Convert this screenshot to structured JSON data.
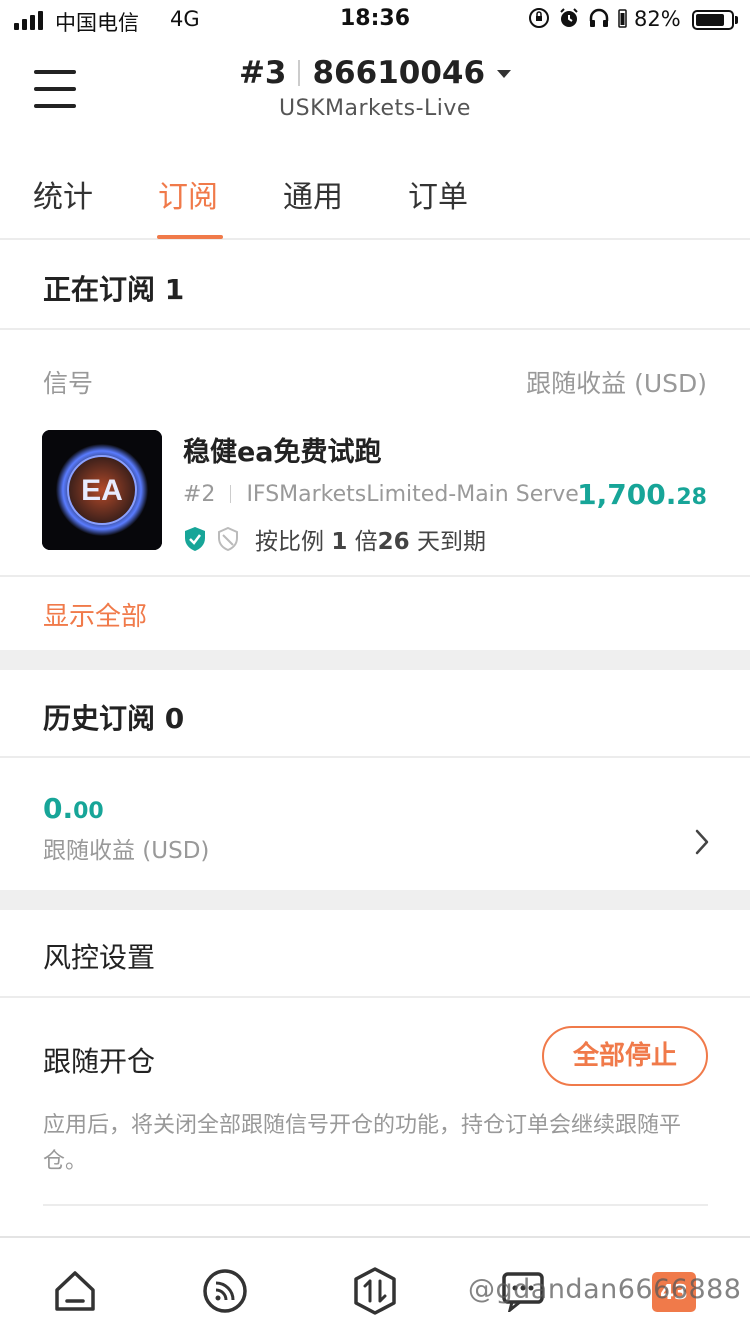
{
  "status_bar": {
    "carrier": "中国电信",
    "network": "4G",
    "time": "18:36",
    "battery": "82%",
    "battery_level": 0.82
  },
  "header": {
    "account_prefix": "#3",
    "account_number": "86610046",
    "server": "USKMarkets-Live"
  },
  "tabs": [
    {
      "label": "统计",
      "active": false
    },
    {
      "label": "订阅",
      "active": true
    },
    {
      "label": "通用",
      "active": false
    },
    {
      "label": "订单",
      "active": false
    }
  ],
  "current_subscriptions": {
    "title": "正在订阅 1",
    "col_signal": "信号",
    "col_profit": "跟随收益 (USD)",
    "item": {
      "name": "稳健ea免费试跑",
      "rank": "#2",
      "server": "IFSMarketsLimited-Main Serve",
      "profit_int": "1,700.",
      "profit_dec": "28",
      "mode_prefix": "按比例 ",
      "ratio": "1",
      "ratio_unit": " 倍",
      "days": "26",
      "days_suffix": " 天到期"
    },
    "show_all": "显示全部"
  },
  "history": {
    "title": "历史订阅 0",
    "amount_int": "0.",
    "amount_dec": "00",
    "amount_label": "跟随收益 (USD)"
  },
  "risk": {
    "title": "风控设置",
    "follow_open": "跟随开仓",
    "stop_all": "全部停止",
    "desc": "应用后，将关闭全部跟随信号开仓的功能，持仓订单会继续跟随平仓。"
  },
  "bottom_nav": {
    "badge": "43",
    "watermark": "@gdandan6666888"
  },
  "colors": {
    "accent": "#f07a4a",
    "profit": "#17a598"
  }
}
